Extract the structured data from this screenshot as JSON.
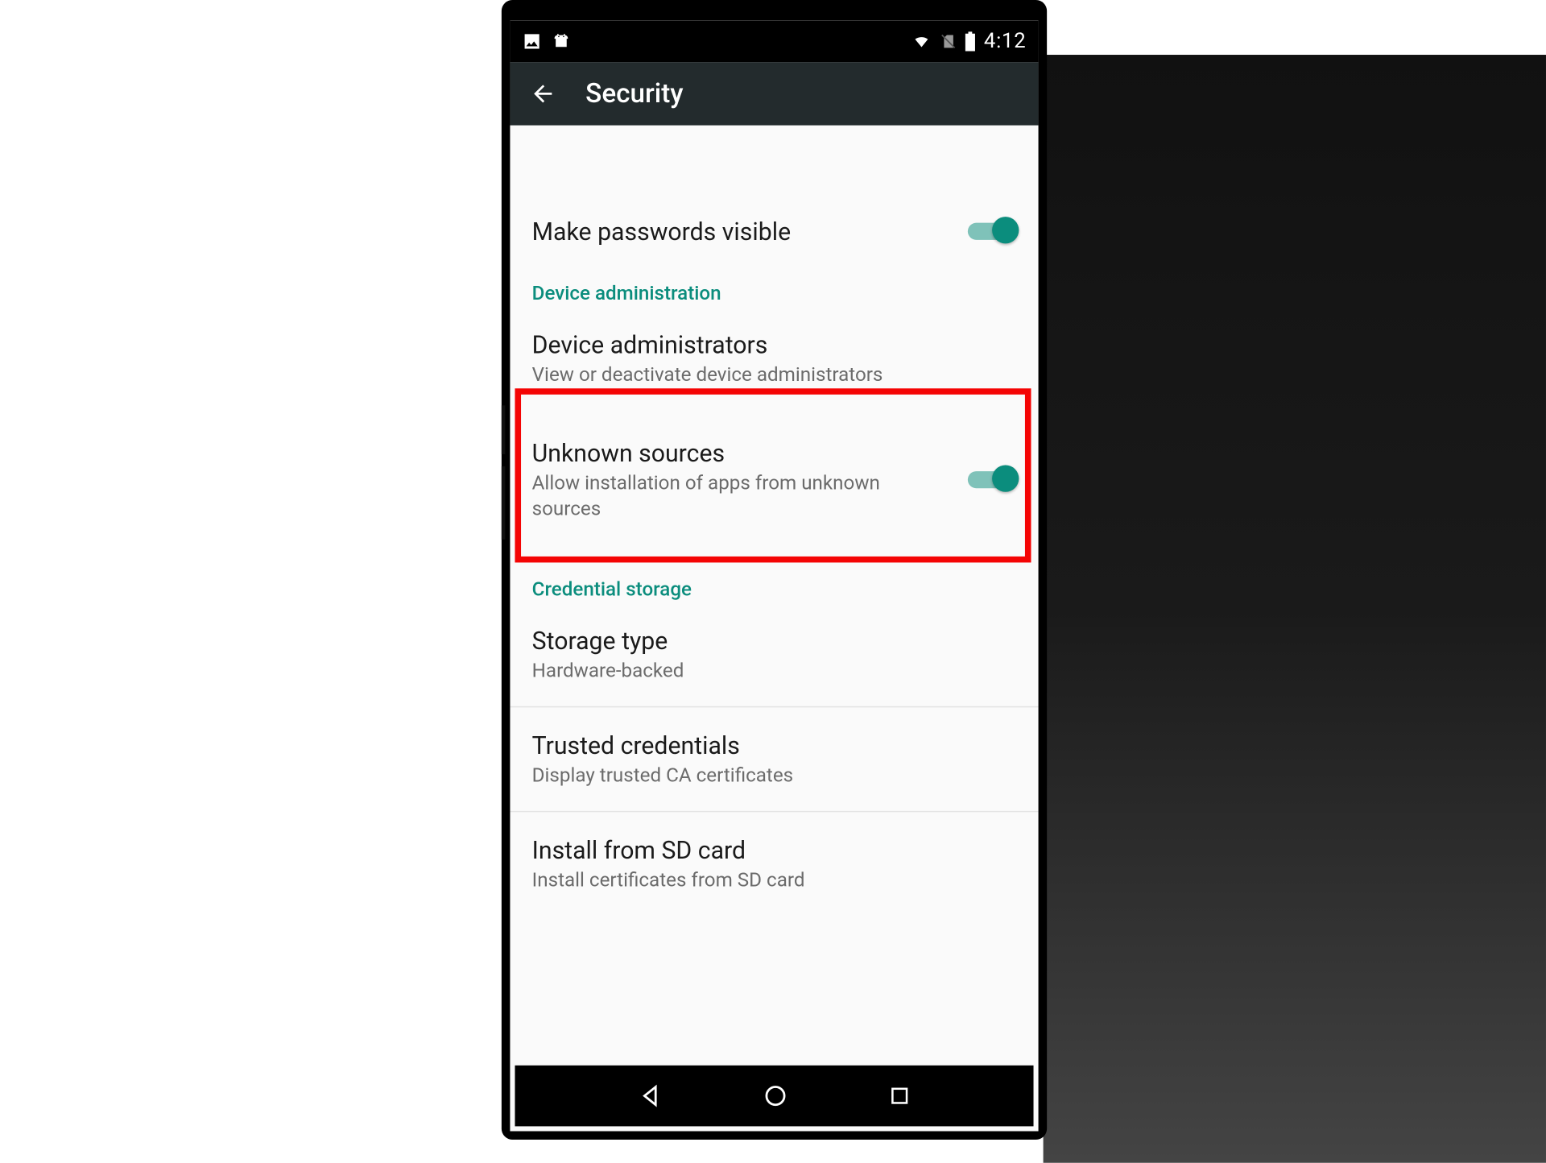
{
  "status": {
    "time": "4:12"
  },
  "header": {
    "title": "Security"
  },
  "sections": {
    "passwords": {
      "title": "Make passwords visible"
    },
    "device_admin": {
      "header": "Device administration",
      "admins": {
        "title": "Device administrators",
        "sub": "View or deactivate device administrators"
      },
      "unknown": {
        "title": "Unknown sources",
        "sub": "Allow installation of apps from unknown sources"
      }
    },
    "cred": {
      "header": "Credential storage",
      "storage": {
        "title": "Storage type",
        "sub": "Hardware-backed"
      },
      "trusted": {
        "title": "Trusted credentials",
        "sub": "Display trusted CA certificates"
      },
      "install": {
        "title": "Install from SD card",
        "sub": "Install certificates from SD card"
      }
    }
  }
}
